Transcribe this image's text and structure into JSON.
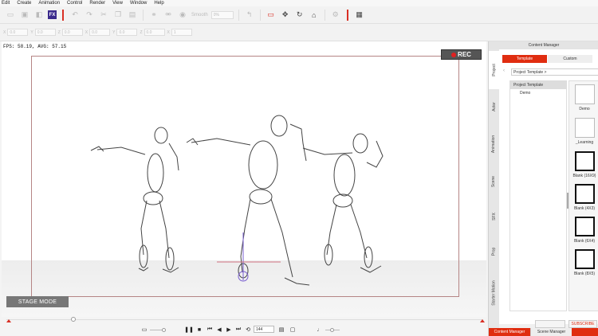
{
  "menu": [
    "Edit",
    "Create",
    "Animation",
    "Control",
    "Render",
    "View",
    "Window",
    "Help"
  ],
  "toolbar": {
    "fx_label": "FX",
    "smooth_label": "Smooth",
    "smooth_value": "0%"
  },
  "toolbar2": {
    "fields": [
      {
        "label": "X",
        "value": "0.0"
      },
      {
        "label": "Y",
        "value": "0.0"
      },
      {
        "label": "Z",
        "value": "0.0"
      },
      {
        "label": "X",
        "value": "0.0"
      },
      {
        "label": "Y",
        "value": "0.0"
      },
      {
        "label": "Z",
        "value": "0.0"
      },
      {
        "label": "X",
        "value": "1"
      }
    ]
  },
  "viewport": {
    "fps_text": "FPS: 58.19, AVG: 57.15",
    "rec_label": "REC",
    "stage_mode_label": "STAGE MODE"
  },
  "transport": {
    "frame_value": "144"
  },
  "timeline": {
    "playhead_fraction": 0.14
  },
  "panel": {
    "title": "Content Manager",
    "vertical_tabs": [
      "Project",
      "Actor",
      "Animation",
      "Scene",
      "SFX",
      "Prop",
      "Starter Motion"
    ],
    "tabs": [
      "Template",
      "Custom"
    ],
    "path": "Project Template >",
    "tree": [
      "Project Template",
      "Demo"
    ],
    "thumbs": [
      "Demo",
      "_Learning",
      "Blank (16X9)",
      "Blank (4X3)",
      "Blank (6X4)",
      "Blank (8X5)"
    ],
    "bottom_buttons": [
      "",
      "SUBSCRIBE"
    ],
    "bottom_tabs": [
      "Content Manager",
      "Scene Manager"
    ]
  },
  "colors": {
    "accent": "#e02d10",
    "stage_bg": "#777777",
    "fx_bg": "#3a2a8c"
  }
}
